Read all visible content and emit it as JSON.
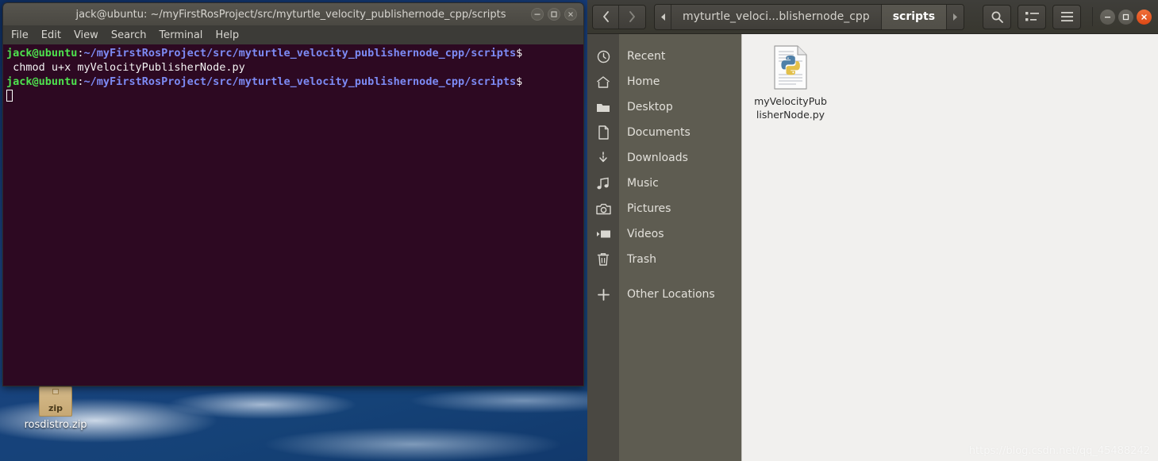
{
  "terminal": {
    "title": "jack@ubuntu: ~/myFirstRosProject/src/myturtle_velocity_publishernode_cpp/scripts",
    "window_buttons": [
      {
        "name": "minimize",
        "glyph": "–"
      },
      {
        "name": "maximize",
        "glyph": "□"
      },
      {
        "name": "close",
        "glyph": "×"
      }
    ],
    "menu": [
      "File",
      "Edit",
      "View",
      "Search",
      "Terminal",
      "Help"
    ],
    "prompt_user": "jack@ubuntu",
    "prompt_colon": ":",
    "prompt_path": "~/myFirstRosProject/src/myturtle_velocity_publishernode_cpp/scripts",
    "prompt_dollar": "$",
    "command": " chmod u+x myVelocityPublisherNode.py",
    "colors": {
      "background": "#2d0922",
      "user": "#4ee24e",
      "path": "#7d8bf5",
      "text": "#f2f2f2"
    }
  },
  "nautilus": {
    "nav": {
      "back": "❮",
      "forward": "❯"
    },
    "pathbar": {
      "left_arrow": "◀",
      "segments": [
        {
          "label": "myturtle_veloci...blishernode_cpp",
          "active": false
        },
        {
          "label": "scripts",
          "active": true
        }
      ],
      "right_arrow": "▶"
    },
    "toolbar": [
      {
        "name": "search-icon",
        "label": "Search"
      },
      {
        "name": "list-view-icon",
        "label": "View options"
      },
      {
        "name": "hamburger-menu-icon",
        "label": "Menu"
      }
    ],
    "window_buttons": [
      {
        "name": "minimize",
        "glyph": "–"
      },
      {
        "name": "maximize",
        "glyph": "□"
      },
      {
        "name": "close",
        "glyph": "×"
      }
    ],
    "sidebar": {
      "items": [
        {
          "label": "Recent",
          "icon": "clock-icon"
        },
        {
          "label": "Home",
          "icon": "home-icon"
        },
        {
          "label": "Desktop",
          "icon": "folder-icon"
        },
        {
          "label": "Documents",
          "icon": "document-icon"
        },
        {
          "label": "Downloads",
          "icon": "download-icon"
        },
        {
          "label": "Music",
          "icon": "music-note-icon"
        },
        {
          "label": "Pictures",
          "icon": "camera-icon"
        },
        {
          "label": "Videos",
          "icon": "video-icon"
        },
        {
          "label": "Trash",
          "icon": "trash-icon"
        },
        {
          "label": "Other Locations",
          "icon": "plus-icon"
        }
      ]
    },
    "files": [
      {
        "name": "myVelocityPublisherNode.py",
        "icon": "python-file-icon"
      }
    ],
    "colors": {
      "header": "#3f3e3a",
      "sidebar": "#5e5c51",
      "content": "#f1f0ee"
    }
  },
  "desktop": {
    "icons": [
      {
        "label": "rosdistro.zip",
        "icon": "zip-archive-icon",
        "badge": "zip"
      }
    ],
    "watermark": "https://blog.csdn.net/qq_45488242"
  }
}
